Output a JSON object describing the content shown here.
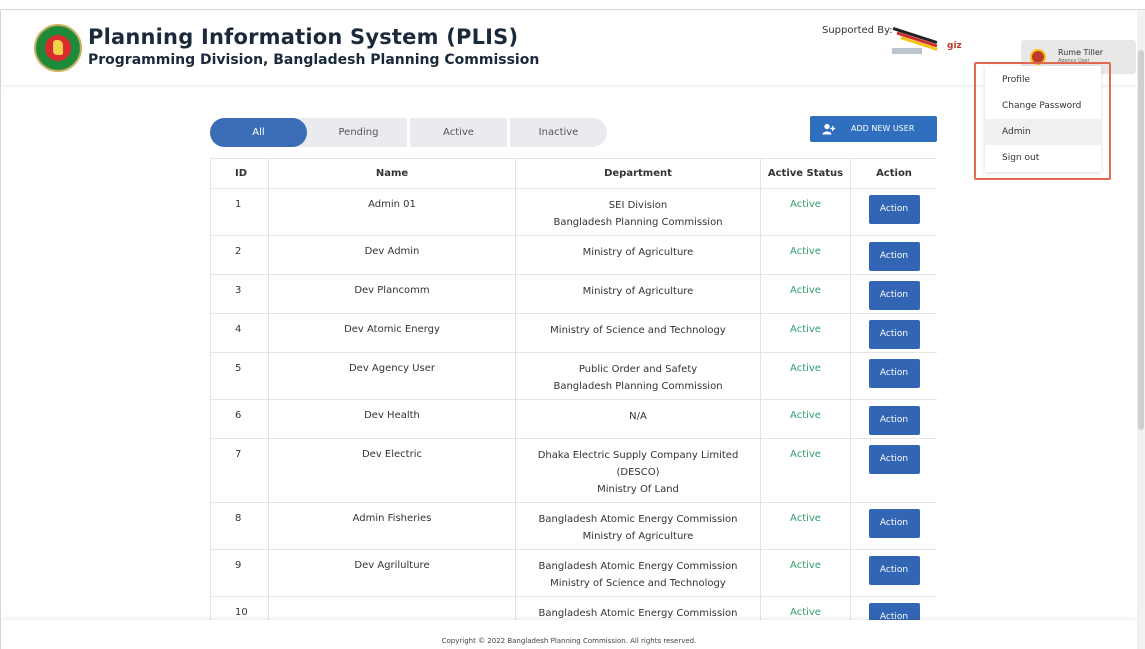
{
  "header": {
    "title": "Planning Information System (PLIS)",
    "subtitle": "Programming Division, Bangladesh Planning Commission",
    "supported_by": "Supported By:",
    "sponsor_2": "giz"
  },
  "user": {
    "name": "Rume Tiller",
    "role": "Agency User"
  },
  "user_menu": [
    {
      "label": "Profile"
    },
    {
      "label": "Change Password"
    },
    {
      "label": "Admin"
    },
    {
      "label": "Sign out"
    }
  ],
  "tabs": [
    {
      "label": "All"
    },
    {
      "label": "Pending"
    },
    {
      "label": "Active"
    },
    {
      "label": "Inactive"
    }
  ],
  "add_user_label": "ADD NEW USER",
  "table": {
    "headers": [
      "ID",
      "Name",
      "Department",
      "Active Status",
      "Action"
    ],
    "rows": [
      {
        "id": "1",
        "name": "Admin 01",
        "dept": [
          "SEI Division",
          "Bangladesh Planning Commission"
        ],
        "status": "Active",
        "action": "Action"
      },
      {
        "id": "2",
        "name": "Dev Admin",
        "dept": [
          "Ministry of Agriculture"
        ],
        "status": "Active",
        "action": "Action"
      },
      {
        "id": "3",
        "name": "Dev Plancomm",
        "dept": [
          "Ministry of Agriculture"
        ],
        "status": "Active",
        "action": "Action"
      },
      {
        "id": "4",
        "name": "Dev Atomic Energy",
        "dept": [
          "Ministry of Science and Technology"
        ],
        "status": "Active",
        "action": "Action"
      },
      {
        "id": "5",
        "name": "Dev Agency User",
        "dept": [
          "Public Order and Safety",
          "Bangladesh Planning Commission"
        ],
        "status": "Active",
        "action": "Action"
      },
      {
        "id": "6",
        "name": "Dev Health",
        "dept": [
          "N/A"
        ],
        "status": "Active",
        "action": "Action"
      },
      {
        "id": "7",
        "name": "Dev Electric",
        "dept": [
          "Dhaka Electric Supply Company Limited",
          "(DESCO)",
          "Ministry Of Land"
        ],
        "status": "Active",
        "action": "Action"
      },
      {
        "id": "8",
        "name": "Admin Fisheries",
        "dept": [
          "Bangladesh Atomic Energy Commission",
          "Ministry of Agriculture"
        ],
        "status": "Active",
        "action": "Action"
      },
      {
        "id": "9",
        "name": "Dev Agrilulture",
        "dept": [
          "Bangladesh Atomic Energy Commission",
          "Ministry of Science and Technology"
        ],
        "status": "Active",
        "action": "Action"
      },
      {
        "id": "10",
        "name": "",
        "dept": [
          "Bangladesh Atomic Energy Commission"
        ],
        "status": "Active",
        "action": "Action"
      }
    ]
  },
  "footer": {
    "copyright": "Copyright © 2022 Bangladesh Planning Commission. All rights reserved."
  },
  "colors": {
    "primary": "#3265b3",
    "status_active": "#2e9e6a",
    "highlight": "#e0694f"
  }
}
